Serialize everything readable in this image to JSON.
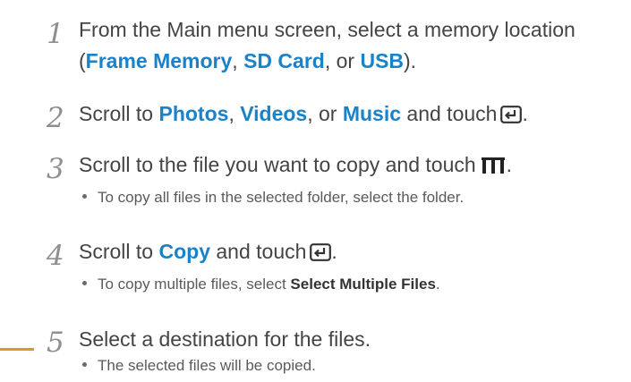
{
  "steps": [
    {
      "number": "1",
      "line1": "From the Main menu screen, select a memory location",
      "line2_open": "(",
      "loc1": "Frame Memory",
      "sep1": ", ",
      "loc2": "SD Card",
      "sep2": ", or ",
      "loc3": "USB",
      "line2_close": ")."
    },
    {
      "number": "2",
      "text_a": "Scroll to ",
      "opt1": "Photos",
      "sep1": ", ",
      "opt2": "Videos",
      "sep2": ", or ",
      "opt3": "Music",
      "text_b": " and touch",
      "end": ".",
      "icon": "enter-icon"
    },
    {
      "number": "3",
      "text": "Scroll to the file you want to copy and touch",
      "end": ".",
      "icon": "menu-icon",
      "bullet": "To copy all files in the selected folder, select the folder."
    },
    {
      "number": "4",
      "text_a": "Scroll to ",
      "opt": "Copy",
      "text_b": " and touch",
      "end": ".",
      "icon": "enter-icon",
      "bullet_a": "To copy multiple files, select ",
      "bullet_bold": "Select Multiple Files",
      "bullet_end": "."
    },
    {
      "number": "5",
      "text": "Select a destination for the files.",
      "bullet": "The selected files will be copied."
    }
  ],
  "colors": {
    "highlight": "#1a82c9",
    "marker": "#e8912b",
    "step_number": "#8f8f8f"
  }
}
